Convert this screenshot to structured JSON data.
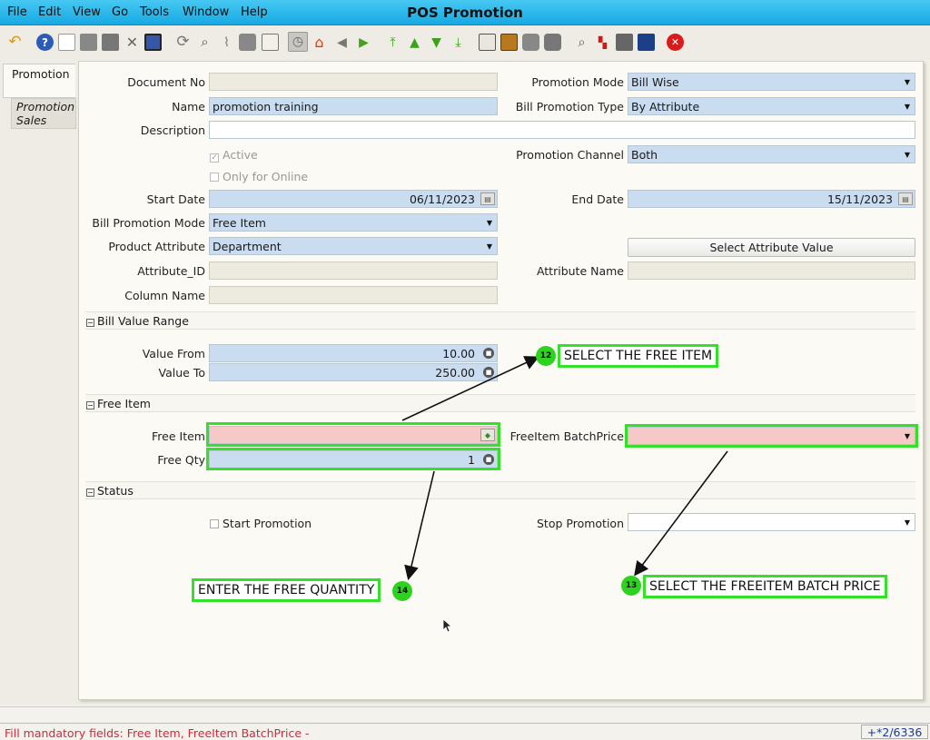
{
  "window": {
    "title": "POS Promotion",
    "menu": [
      "File",
      "Edit",
      "View",
      "Go",
      "Tools",
      "Window",
      "Help"
    ]
  },
  "toolbar": {
    "icons": [
      "undo-icon",
      "help-icon",
      "new-icon",
      "copy-icon",
      "delete-icon",
      "delete-selection-icon",
      "save-icon",
      "refresh-icon",
      "find-icon",
      "attachment-icon",
      "chat-icon",
      "grid-toggle-icon",
      "history-icon",
      "home-icon",
      "back-icon",
      "forward-icon",
      "first-record-icon",
      "previous-record-icon",
      "next-record-icon",
      "last-record-icon",
      "report-icon",
      "archive-icon",
      "print-preview-icon",
      "print-icon",
      "zoom-across-icon",
      "workflow-icon",
      "request-icon",
      "product-info-icon",
      "close-window-icon"
    ]
  },
  "tabs": {
    "active": "Promotion",
    "inactive": "Promotion Sales"
  },
  "form": {
    "document_no": {
      "label": "Document No",
      "value": ""
    },
    "name": {
      "label": "Name",
      "value": "promotion training"
    },
    "description": {
      "label": "Description",
      "value": ""
    },
    "active": {
      "label": "Active",
      "checked": true
    },
    "only_online": {
      "label": "Only for Online",
      "checked": false
    },
    "start_date": {
      "label": "Start Date",
      "value": "06/11/2023"
    },
    "bill_promotion_mode": {
      "label": "Bill Promotion Mode",
      "value": "Free Item"
    },
    "product_attribute": {
      "label": "Product Attribute",
      "value": "Department"
    },
    "attribute_id": {
      "label": "Attribute_ID",
      "value": ""
    },
    "column_name": {
      "label": "Column Name",
      "value": ""
    },
    "promotion_mode": {
      "label": "Promotion Mode",
      "value": "Bill Wise"
    },
    "bill_promotion_type": {
      "label": "Bill Promotion Type",
      "value": "By Attribute"
    },
    "promotion_channel": {
      "label": "Promotion Channel",
      "value": "Both"
    },
    "end_date": {
      "label": "End Date",
      "value": "15/11/2023"
    },
    "select_attribute_button": "Select Attribute Value",
    "attribute_name": {
      "label": "Attribute Name",
      "value": ""
    }
  },
  "sections": {
    "bill_value_range": "Bill Value Range",
    "free_item": "Free Item",
    "status": "Status"
  },
  "bill_value": {
    "value_from": {
      "label": "Value From",
      "value": "10.00"
    },
    "value_to": {
      "label": "Value To",
      "value": "250.00"
    }
  },
  "free_item": {
    "free_item": {
      "label": "Free Item",
      "value": ""
    },
    "free_qty": {
      "label": "Free Qty",
      "value": "1"
    },
    "batch_price": {
      "label": "FreeItem BatchPrice",
      "value": ""
    }
  },
  "status": {
    "start_promotion": {
      "label": "Start Promotion",
      "checked": false
    },
    "stop_promotion": {
      "label": "Stop Promotion",
      "value": ""
    }
  },
  "annotations": {
    "a12": {
      "number": "12",
      "text": "SELECT THE FREE ITEM"
    },
    "a13": {
      "number": "13",
      "text": "SELECT THE FREEITEM BATCH PRICE"
    },
    "a14": {
      "number": "14",
      "text": "ENTER THE FREE QUANTITY"
    },
    "highlight_color": "#35e02a"
  },
  "statusbar": {
    "message": "Fill mandatory fields: Free Item, FreeItem BatchPrice -",
    "info": "+*2/6336",
    "message_color": "#d4283c"
  }
}
